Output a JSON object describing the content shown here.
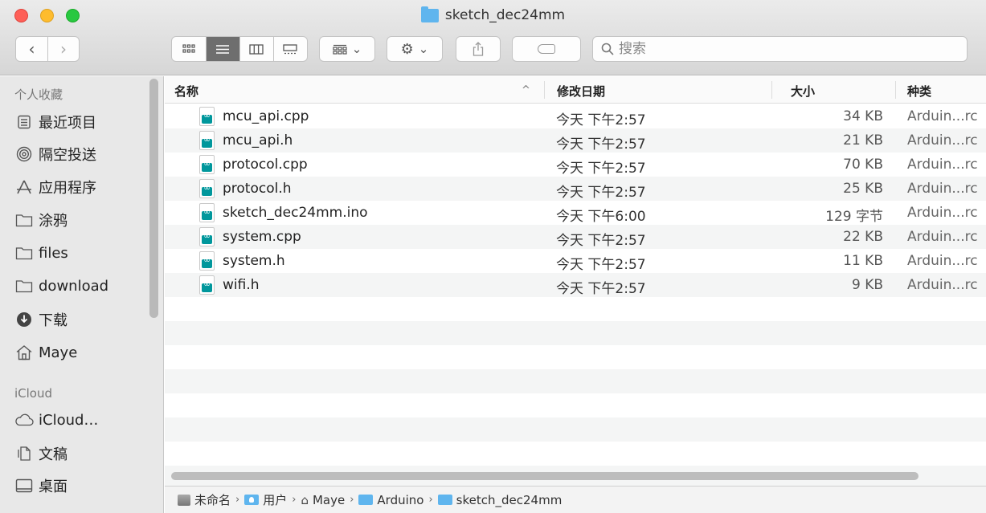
{
  "window": {
    "title": "sketch_dec24mm"
  },
  "toolbar": {
    "back_glyph": "‹",
    "forward_glyph": "›",
    "view_modes": [
      "icon-view",
      "list-view",
      "column-view",
      "gallery-view"
    ],
    "active_view": "list-view",
    "chevron": "⌄",
    "search": {
      "placeholder": "搜索",
      "value": ""
    }
  },
  "sidebar": {
    "favorites_header": "个人收藏",
    "favorites": [
      {
        "label": "最近项目",
        "icon": "recents-icon"
      },
      {
        "label": "隔空投送",
        "icon": "airdrop-icon"
      },
      {
        "label": "应用程序",
        "icon": "applications-icon"
      },
      {
        "label": "涂鸦",
        "icon": "folder-icon"
      },
      {
        "label": "files",
        "icon": "folder-icon"
      },
      {
        "label": "download",
        "icon": "folder-icon"
      },
      {
        "label": "下载",
        "icon": "downloads-icon"
      },
      {
        "label": "Maye",
        "icon": "home-icon"
      }
    ],
    "icloud_header": "iCloud",
    "icloud": [
      {
        "label": "iCloud…",
        "icon": "cloud-icon"
      },
      {
        "label": "文稿",
        "icon": "documents-icon"
      },
      {
        "label": "桌面",
        "icon": "desktop-icon"
      }
    ]
  },
  "columns": {
    "name": "名称",
    "sort_indicator": "^",
    "date": "修改日期",
    "size": "大小",
    "kind": "种类"
  },
  "files": [
    {
      "name": "mcu_api.cpp",
      "date": "今天 下午2:57",
      "size": "34 KB",
      "kind": "Arduin...rc"
    },
    {
      "name": "mcu_api.h",
      "date": "今天 下午2:57",
      "size": "21 KB",
      "kind": "Arduin...rc"
    },
    {
      "name": "protocol.cpp",
      "date": "今天 下午2:57",
      "size": "70 KB",
      "kind": "Arduin...rc"
    },
    {
      "name": "protocol.h",
      "date": "今天 下午2:57",
      "size": "25 KB",
      "kind": "Arduin...rc"
    },
    {
      "name": "sketch_dec24mm.ino",
      "date": "今天 下午6:00",
      "size": "129 字节",
      "kind": "Arduin...rc"
    },
    {
      "name": "system.cpp",
      "date": "今天 下午2:57",
      "size": "22 KB",
      "kind": "Arduin...rc"
    },
    {
      "name": "system.h",
      "date": "今天 下午2:57",
      "size": "11 KB",
      "kind": "Arduin...rc"
    },
    {
      "name": "wifi.h",
      "date": "今天 下午2:57",
      "size": "9 KB",
      "kind": "Arduin...rc"
    }
  ],
  "pathbar": {
    "separator": "›",
    "crumbs": [
      "未命名",
      "用户",
      "Maye",
      "Arduino",
      "sketch_dec24mm"
    ]
  },
  "colors": {
    "folder_blue": "#5fb5ee",
    "arduino_teal": "#00979c",
    "close": "#fe5f57",
    "minimize": "#febc2e",
    "maximize": "#28c840"
  }
}
